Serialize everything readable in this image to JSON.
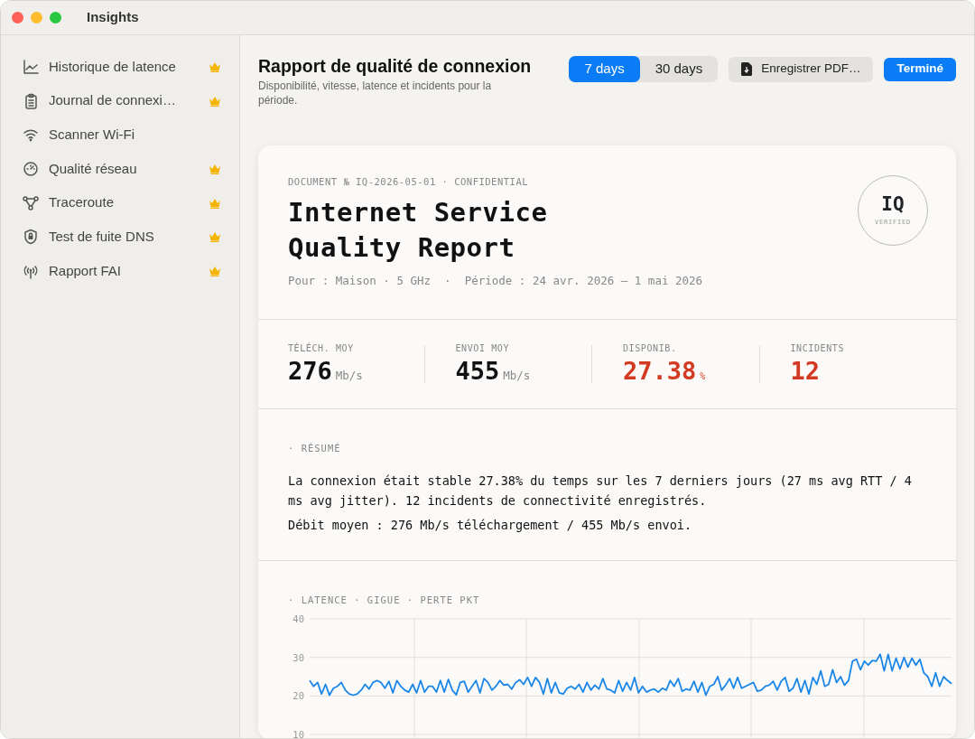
{
  "window": {
    "title": "Insights"
  },
  "sidebar": {
    "items": [
      {
        "label": "Historique de latence",
        "premium": true
      },
      {
        "label": "Journal de connexi…",
        "premium": true
      },
      {
        "label": "Scanner Wi-Fi",
        "premium": false
      },
      {
        "label": "Qualité réseau",
        "premium": true
      },
      {
        "label": "Traceroute",
        "premium": true
      },
      {
        "label": "Test de fuite DNS",
        "premium": true
      },
      {
        "label": "Rapport FAI",
        "premium": true
      }
    ]
  },
  "header": {
    "title": "Rapport de qualité de connexion",
    "subtitle": "Disponibilité, vitesse, latence et incidents pour la période.",
    "periods": [
      {
        "label": "7 days",
        "selected": true
      },
      {
        "label": "30 days",
        "selected": false
      }
    ],
    "save_button": "Enregistrer PDF…",
    "done_button": "Terminé"
  },
  "report": {
    "doc_id": "DOCUMENT № IQ-2026-05-01 · CONFIDENTIAL",
    "title": "Internet Service Quality Report",
    "meta": "Pour : Maison · 5 GHz  ·  Période : 24 avr. 2026 — 1 mai 2026",
    "seal": {
      "mark": "IQ",
      "caption": "VERIFIED"
    },
    "stats": [
      {
        "label": "TÉLÉCH. MOY",
        "value": "276",
        "unit": "Mb/s",
        "alert": false
      },
      {
        "label": "ENVOI MOY",
        "value": "455",
        "unit": "Mb/s",
        "alert": false
      },
      {
        "label": "DISPONIB.",
        "value": "27.38",
        "unit": "%",
        "alert": true
      },
      {
        "label": "INCIDENTS",
        "value": "12",
        "alert": true
      }
    ],
    "summary": {
      "heading": "· RÉSUMÉ",
      "paragraphs": [
        "La connexion était stable 27.38% du temps sur les 7 derniers jours (27 ms avg RTT / 4 ms avg jitter). 12 incidents de connectivité enregistrés.",
        "Débit moyen : 276 Mb/s téléchargement / 455 Mb/s envoi."
      ]
    },
    "chart": {
      "heading": "· LATENCE · GIGUE · PERTE PKT",
      "chart_data": {
        "type": "line",
        "ylim": [
          10,
          40
        ],
        "yticks": [
          10,
          20,
          30,
          40
        ],
        "series": [
          {
            "color": "#1a86e8",
            "values": [
              24,
              22.5,
              23.5,
              20.5,
              23,
              20.2,
              22,
              22.5,
              23.5,
              21.5,
              20.5,
              20.2,
              20.5,
              21.5,
              23,
              21.8,
              23.5,
              24,
              23.5,
              22,
              23.8,
              20.8,
              24,
              22.5,
              21.5,
              21,
              23,
              20.8,
              24,
              21,
              22.5,
              22.5,
              21,
              24,
              21,
              24.3,
              21.5,
              20.3,
              23.5,
              23.8,
              21,
              22.5,
              24,
              20.8,
              24.5,
              23.5,
              21.5,
              22.5,
              24,
              22.8,
              23,
              21.8,
              23.5,
              24.2,
              23,
              24.8,
              22.5,
              24.8,
              23.5,
              20.5,
              24.5,
              20.8,
              23.5,
              20.8,
              20.5,
              22,
              22.5,
              21.8,
              23,
              21,
              23.5,
              21.5,
              22.8,
              21.8,
              24.5,
              21.8,
              21.5,
              20.8,
              24,
              21.2,
              23.5,
              21.5,
              24.8,
              20.8,
              22.5,
              21,
              21.5,
              21.8,
              21,
              22,
              21.5,
              24,
              22.5,
              24.5,
              21.2,
              21.8,
              21.5,
              23.8,
              21,
              23.5,
              20.2,
              22.5,
              23,
              25,
              21.5,
              22.8,
              24.5,
              22,
              24.8,
              22,
              22.5,
              23,
              23.5,
              21.2,
              21.5,
              22.5,
              22.8,
              23.8,
              21.5,
              23.8,
              24.8,
              21.2,
              22,
              24.5,
              21,
              24,
              20.5,
              24.8,
              23,
              26.5,
              22.5,
              23,
              26.8,
              23.5,
              25,
              22.8,
              24,
              29,
              29.5,
              26.8,
              29,
              28,
              29.2,
              29,
              30.8,
              26.5,
              30.8,
              26.5,
              29.8,
              27,
              30,
              27.5,
              29.8,
              28,
              29.5,
              26,
              25,
              22.5,
              26,
              22.5,
              25,
              24,
              23.2
            ]
          }
        ]
      }
    }
  }
}
